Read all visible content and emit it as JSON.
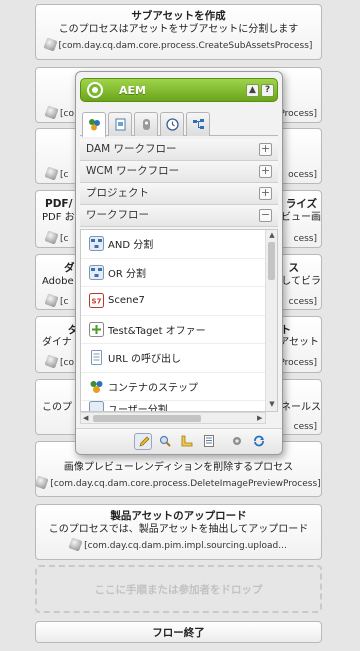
{
  "steps": [
    {
      "title": "サブアセットを作成",
      "desc": "このプロセスはアセットをサブアセットに分割します",
      "process": "[com.day.cq.dam.core.process.CreateSubAssetsProcess]"
    },
    {
      "title": "",
      "desc": "",
      "process": "[co"
    },
    {
      "title": "",
      "desc": "",
      "process": "[c"
    },
    {
      "title": "PDF/",
      "desc": "PDF お",
      "process": "[c"
    },
    {
      "title": "ダ",
      "desc": "Adobe",
      "process": "[c"
    },
    {
      "title": "ダ",
      "desc": "ダイナ",
      "process": "[co"
    },
    {
      "title": "",
      "desc": "このプ",
      "process": ""
    },
    {
      "title": "",
      "desc": "画像プレビューレンディションを削除するプロセス",
      "process": "[com.day.cq.dam.core.process.DeleteImagePreviewProcess]"
    },
    {
      "title": "製品アセットのアップロード",
      "desc": "このプロセスでは、製品アセットを抽出してアップロード",
      "process": "[com.day.cq.dam.pim.impl.sourcing.upload..."
    }
  ],
  "right_fragments": [
    "[com.day.cq.dam.core.process.CreateSubAssetsProcess]",
    "Process]",
    "ocess]",
    "ライズ",
    "ビュー画",
    "cess]",
    "ス",
    "してビラ",
    "ccess]",
    "ト",
    "アセット",
    "Process]",
    "ネールス",
    "cess]"
  ],
  "drop_zone": "ここに手順または参加者をドロップ",
  "flow_end": "フロー終了",
  "sidekick": {
    "title": "AEM",
    "help": "?",
    "categories": [
      {
        "label": "DAM ワークフロー",
        "toggle": "+"
      },
      {
        "label": "WCM ワークフロー",
        "toggle": "+"
      },
      {
        "label": "プロジェクト",
        "toggle": "+"
      },
      {
        "label": "ワークフロー",
        "toggle": "−"
      }
    ],
    "items": [
      {
        "label": "AND 分割",
        "icon": "split-icon"
      },
      {
        "label": "OR 分割",
        "icon": "split-icon"
      },
      {
        "label": "Scene7",
        "icon": "scene7-icon"
      },
      {
        "label": "Test&Taget オファー",
        "icon": "plus-doc-icon"
      },
      {
        "label": "URL の呼び出し",
        "icon": "doc-icon"
      },
      {
        "label": "コンテナのステップ",
        "icon": "people-icon"
      },
      {
        "label": "ユーザー分割",
        "icon": "split-icon"
      }
    ]
  },
  "colors": {
    "header_green": "#7ab92c",
    "panel_bg": "#f2f2f2",
    "page_bg": "#e6e6e6"
  }
}
